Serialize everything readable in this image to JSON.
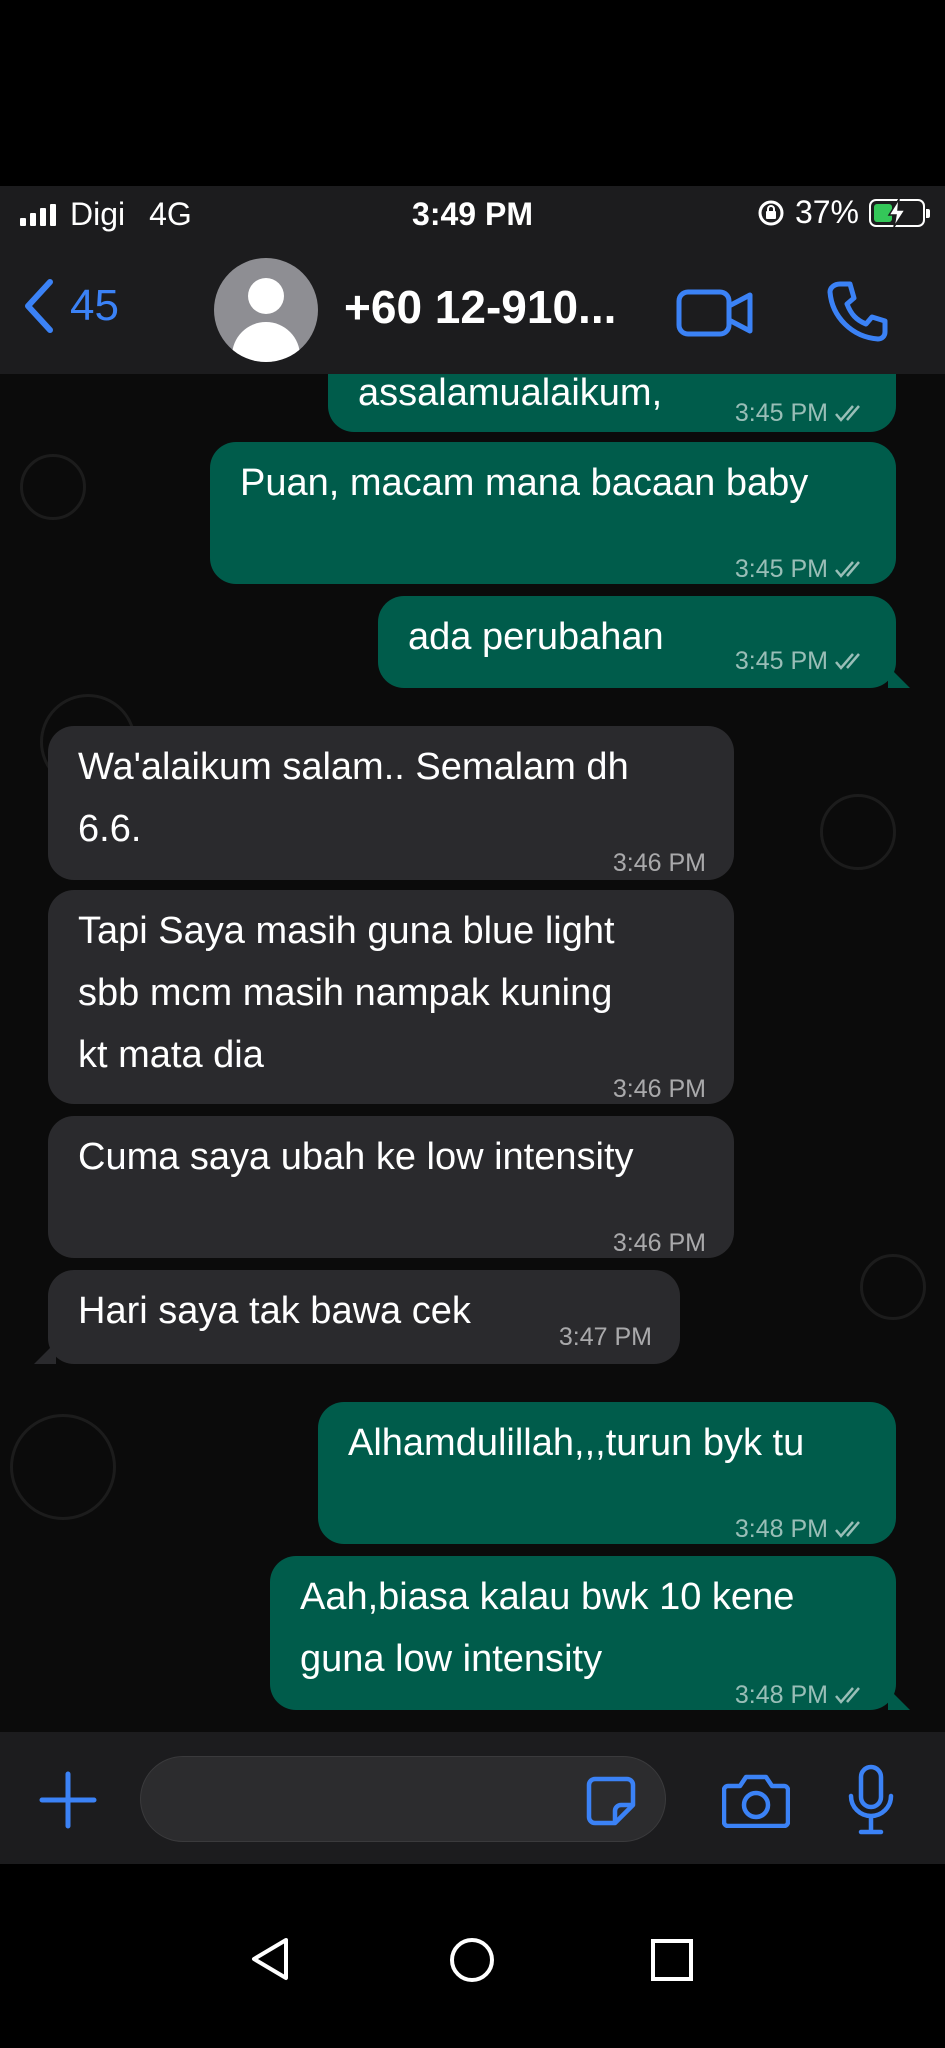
{
  "status": {
    "carrier": "Digi",
    "network": "4G",
    "time": "3:49 PM",
    "battery": "37%"
  },
  "header": {
    "back_count": "45",
    "contact": "+60 12-910..."
  },
  "messages": [
    {
      "dir": "out",
      "text": "assalamualaikum,",
      "time": "3:45 PM"
    },
    {
      "dir": "out",
      "text": "Puan, macam mana bacaan baby",
      "time": "3:45 PM"
    },
    {
      "dir": "out",
      "text": "ada perubahan",
      "time": "3:45 PM"
    },
    {
      "dir": "in",
      "text": "Wa'alaikum salam.. Semalam dh\n6.6.",
      "time": "3:46 PM"
    },
    {
      "dir": "in",
      "text": "Tapi Saya masih guna blue light\nsbb mcm masih nampak kuning\nkt mata dia",
      "time": "3:46 PM"
    },
    {
      "dir": "in",
      "text": "Cuma saya ubah ke low intensity",
      "time": "3:46 PM"
    },
    {
      "dir": "in",
      "text": "Hari saya tak bawa cek",
      "time": "3:47 PM"
    },
    {
      "dir": "out",
      "text": "Alhamdulillah,,,turun byk tu",
      "time": "3:48 PM"
    },
    {
      "dir": "out",
      "text": "Aah,biasa kalau bwk 10 kene\nguna low intensity",
      "time": "3:48 PM"
    }
  ],
  "icons": {
    "back": "chevron-left-icon",
    "video": "video-call-icon",
    "call": "phone-icon",
    "add": "plus-icon",
    "sticker": "sticker-icon",
    "camera": "camera-icon",
    "mic": "microphone-icon"
  },
  "colors": {
    "accent": "#3b82f6",
    "outgoing": "#005c4b",
    "incoming": "#2a2a2d",
    "battery": "#34c759"
  }
}
